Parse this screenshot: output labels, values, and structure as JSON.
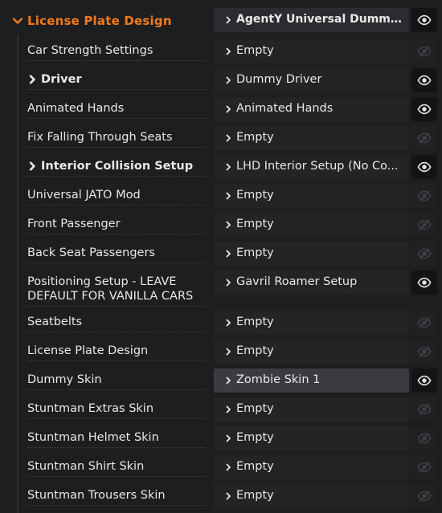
{
  "header": {
    "title": "License Plate Design",
    "value": "AgentY Universal Dummy ...",
    "visible": true
  },
  "rows": [
    {
      "label": "Car Strength Settings",
      "bold": false,
      "value": "Empty",
      "visible": false
    },
    {
      "label": "Driver",
      "bold": true,
      "value": "Dummy Driver",
      "visible": true
    },
    {
      "label": "Animated Hands",
      "bold": false,
      "value": "Animated Hands",
      "visible": true
    },
    {
      "label": "Fix Falling Through Seats",
      "bold": false,
      "value": "Empty",
      "visible": false
    },
    {
      "label": "Interior Collision Setup",
      "bold": true,
      "value": "LHD Interior Setup (No Co...",
      "visible": true
    },
    {
      "label": "Universal JATO Mod",
      "bold": false,
      "value": "Empty",
      "visible": false
    },
    {
      "label": "Front Passenger",
      "bold": false,
      "value": "Empty",
      "visible": false
    },
    {
      "label": "Back Seat Passengers",
      "bold": false,
      "value": "Empty",
      "visible": false
    },
    {
      "label": "Positioning Setup - LEAVE DEFAULT FOR VANILLA CARS",
      "bold": false,
      "value": "Gavril Roamer Setup",
      "visible": true
    },
    {
      "label": "Seatbelts",
      "bold": false,
      "value": "Empty",
      "visible": false
    },
    {
      "label": "License Plate Design",
      "bold": false,
      "value": "Empty",
      "visible": false
    },
    {
      "label": "Dummy Skin",
      "bold": false,
      "value": "Zombie Skin 1",
      "visible": true,
      "highlight": true
    },
    {
      "label": "Stuntman Extras Skin",
      "bold": false,
      "value": "Empty",
      "visible": false
    },
    {
      "label": "Stuntman Helmet Skin",
      "bold": false,
      "value": "Empty",
      "visible": false
    },
    {
      "label": "Stuntman Shirt Skin",
      "bold": false,
      "value": "Empty",
      "visible": false
    },
    {
      "label": "Stuntman Trousers Skin",
      "bold": false,
      "value": "Empty",
      "visible": false
    }
  ],
  "colors": {
    "accent": "#f07a1e",
    "background": "#1d1e20",
    "field": "#232426",
    "field_highlight": "#3a3c40",
    "eye_on": "#e6e6e6",
    "eye_off": "#3e4043"
  },
  "icons": {
    "expand": "chevron-down-icon",
    "collapsed": "chevron-right-icon",
    "dropdown": "chevron-right-icon",
    "visible": "eye-icon",
    "hidden": "eye-off-icon"
  }
}
